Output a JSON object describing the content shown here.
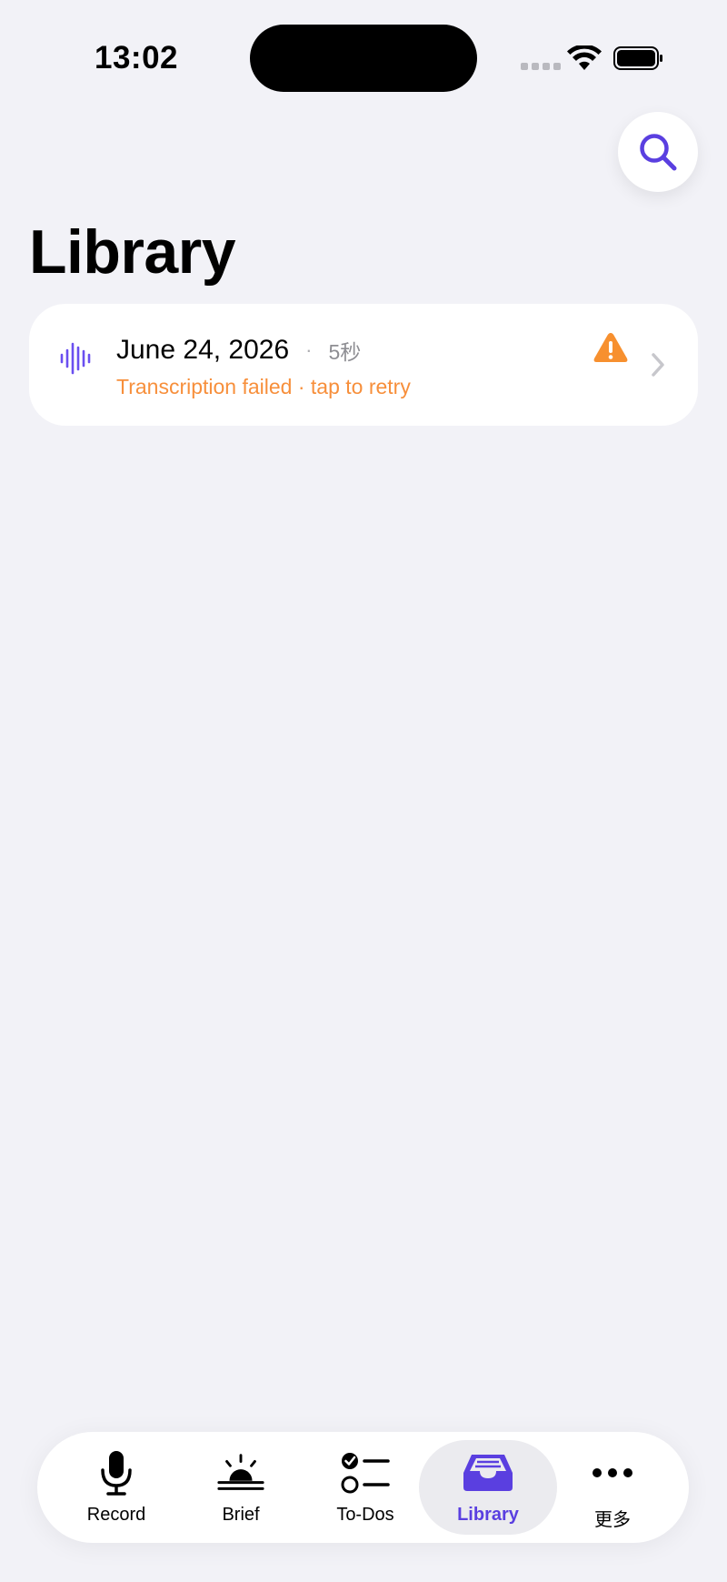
{
  "status_bar": {
    "time": "13:02"
  },
  "header": {
    "title": "Library",
    "search_icon": "search-icon"
  },
  "recordings": [
    {
      "date": "June 24, 2026",
      "separator": "·",
      "duration": "5秒",
      "status": "Transcription failed · tap to retry",
      "icon": "waveform-icon",
      "status_icon": "warning-icon"
    }
  ],
  "tab_bar": {
    "tabs": [
      {
        "label": "Record",
        "icon": "mic-icon"
      },
      {
        "label": "Brief",
        "icon": "sunrise-icon"
      },
      {
        "label": "To-Dos",
        "icon": "checklist-icon"
      },
      {
        "label": "Library",
        "icon": "tray-icon",
        "active": true
      },
      {
        "label": "更多",
        "icon": "more-icon"
      }
    ]
  },
  "colors": {
    "accent": "#5a3fe0",
    "warning": "#f7902f",
    "background": "#f2f2f7"
  }
}
